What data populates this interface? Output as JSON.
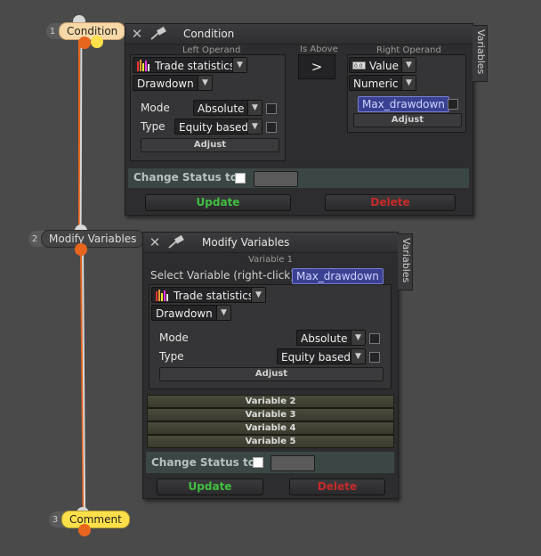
{
  "nodes": [
    {
      "num": "1",
      "label": "Condition"
    },
    {
      "num": "2",
      "label": "Modify Variables"
    },
    {
      "num": "3",
      "label": "Comment"
    }
  ],
  "condition_panel": {
    "title": "Condition",
    "side_tab": "Variables",
    "left_operand_label": "Left Operand",
    "is_above_label": "Is Above",
    "right_operand_label": "Right Operand",
    "left_source": "Trade statistics",
    "left_stat": "Drawdown",
    "mode_label": "Mode",
    "mode_value": "Absolute",
    "type_label": "Type",
    "type_value": "Equity based",
    "adjust_label": "Adjust",
    "comparator": ">",
    "right_source": "Value",
    "right_kind": "Numeric",
    "right_variable": "Max_drawdown",
    "right_adjust_label": "Adjust",
    "change_status_label": "Change Status to",
    "update_label": "Update",
    "delete_label": "Delete"
  },
  "modify_panel": {
    "title": "Modify Variables",
    "side_tab": "Variables",
    "variable_1_label": "Variable 1",
    "select_variable_label": "Select Variable (right-click)",
    "selected_variable": "Max_drawdown",
    "source": "Trade statistics",
    "stat": "Drawdown",
    "mode_label": "Mode",
    "mode_value": "Absolute",
    "type_label": "Type",
    "type_value": "Equity based",
    "adjust_label": "Adjust",
    "variables": [
      "Variable 2",
      "Variable 3",
      "Variable 4",
      "Variable 5"
    ],
    "change_status_label": "Change Status to",
    "update_label": "Update",
    "delete_label": "Delete"
  },
  "colors": {
    "accent_orange": "#e8651e",
    "node_yellow": "#ffe04a",
    "node_peach": "#f7d9a7",
    "update_green": "#3fbf3f",
    "delete_red": "#c62a2a",
    "variable_chip": "#3b4192"
  }
}
